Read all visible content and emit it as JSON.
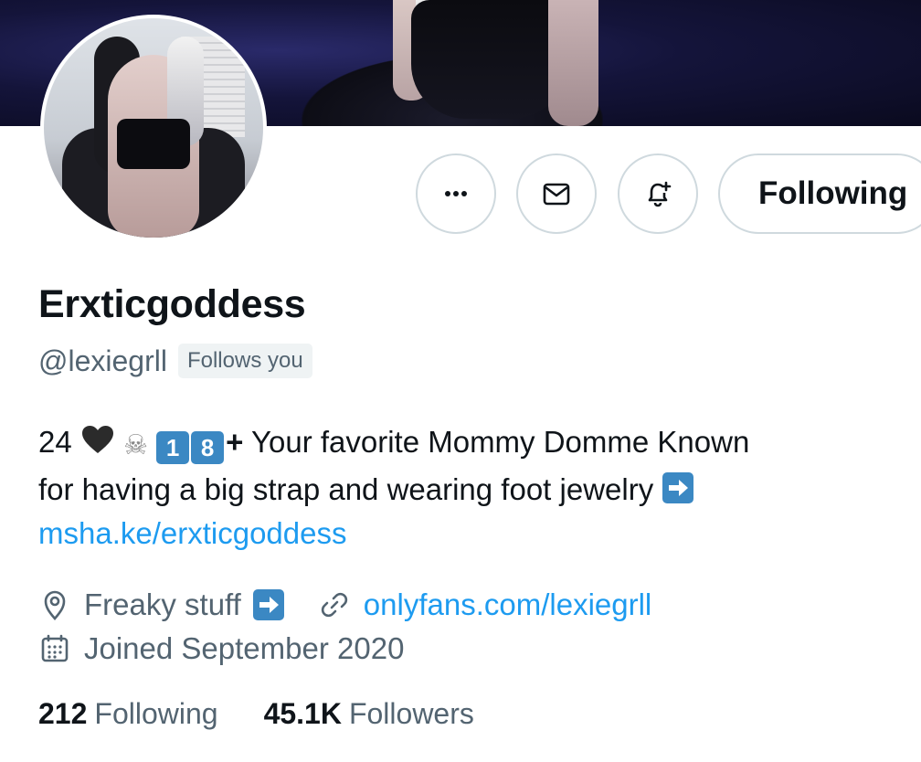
{
  "profile": {
    "display_name": "Erxticgoddess",
    "handle": "@lexiegrll",
    "follows_you_badge": "Follows you"
  },
  "actions": {
    "more_icon": "more-horizontal-icon",
    "message_icon": "envelope-icon",
    "notify_icon": "bell-plus-icon",
    "follow_state_label": "Following"
  },
  "bio": {
    "age": "24",
    "heart_icon": "black-heart",
    "skull_icon": "skull-crossbones",
    "keycap_1": "1",
    "keycap_2": "8",
    "plus": "+",
    "text_line1": "Your favorite Mommy Domme Known",
    "text_line2": "for having a big strap and wearing foot jewelry",
    "arrow_icon": "right-arrow-emoji",
    "link": "msha.ke/erxticgoddess"
  },
  "meta": {
    "location_icon": "location-pin-icon",
    "location": "Freaky stuff",
    "website_icon": "link-icon",
    "website": "onlyfans.com/lexiegrll",
    "joined_icon": "calendar-icon",
    "joined": "Joined September 2020"
  },
  "stats": {
    "following_count": "212",
    "following_label": "Following",
    "followers_count": "45.1K",
    "followers_label": "Followers"
  },
  "colors": {
    "accent_link": "#1d9bf0",
    "secondary_text": "#536471",
    "primary_text": "#0f1419",
    "border": "#cfd9de",
    "keycap_blue": "#3b88c3"
  }
}
